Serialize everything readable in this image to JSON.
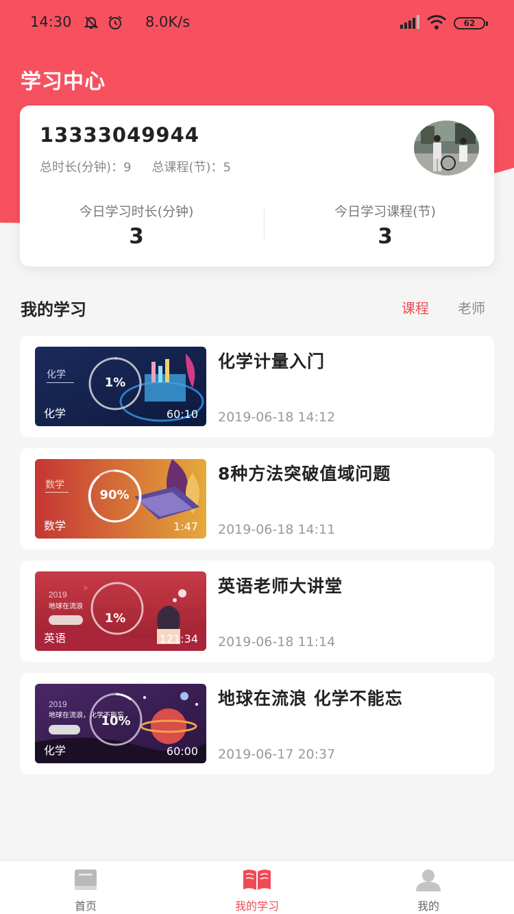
{
  "status_bar": {
    "time": "14:30",
    "speed": "8.0K/s",
    "battery": "62"
  },
  "page_title": "学习中心",
  "user": {
    "phone": "13333049944",
    "total_minutes_label": "总时长(分钟)：9",
    "total_courses_label": "总课程(节)：5",
    "today_minutes_label": "今日学习时长(分钟)",
    "today_minutes_value": "3",
    "today_courses_label": "今日学习课程(节)",
    "today_courses_value": "3"
  },
  "section": {
    "title": "我的学习",
    "tabs": [
      {
        "label": "课程",
        "active": true
      },
      {
        "label": "老师",
        "active": false
      }
    ]
  },
  "courses": [
    {
      "title": "化学计量入门",
      "time": "2019-06-18 14:12",
      "subject": "化学",
      "duration": "60:10",
      "progress": "1%"
    },
    {
      "title": "8种方法突破值域问题",
      "time": "2019-06-18 14:11",
      "subject": "数学",
      "duration": "1:47",
      "progress": "90%"
    },
    {
      "title": "英语老师大讲堂",
      "time": "2019-06-18 11:14",
      "subject": "英语",
      "duration": "121:34",
      "progress": "1%"
    },
    {
      "title": "地球在流浪 化学不能忘",
      "time": "2019-06-17 20:37",
      "subject": "化学",
      "duration": "60:00",
      "progress": "10%"
    }
  ],
  "tabbar": [
    {
      "label": "首页",
      "icon": "book-closed-icon"
    },
    {
      "label": "我的学习",
      "icon": "book-open-icon"
    },
    {
      "label": "我的",
      "icon": "person-icon"
    }
  ],
  "colors": {
    "primary": "#f75160",
    "active": "#f04a55"
  }
}
